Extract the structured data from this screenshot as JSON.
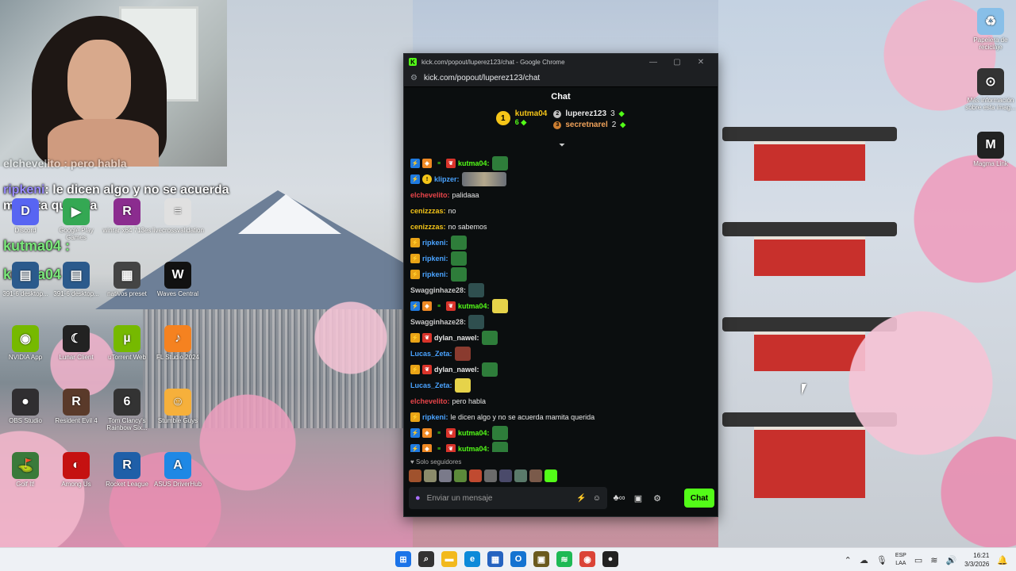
{
  "window": {
    "title": "kick.com/popout/luperez123/chat - Google Chrome",
    "url": "kick.com/popout/luperez123/chat",
    "controls": [
      "—",
      "▢",
      "✕"
    ]
  },
  "chat": {
    "header": "Chat",
    "leaderboard": {
      "first": {
        "rank": "1",
        "name": "kutma04",
        "count": "6"
      },
      "second": {
        "name": "luperez123",
        "count": "3"
      },
      "third": {
        "name": "secretnarel",
        "count": "2"
      }
    },
    "messages": [
      {
        "user": "kutma04",
        "color": "#53fc18",
        "text": "",
        "badges": [
          "blue",
          "orange",
          "green",
          "red"
        ],
        "emote": "green"
      },
      {
        "user": "klipzer",
        "color": "#4aa3ff",
        "text": "",
        "badges": [
          "blue",
          "yellow"
        ],
        "emote": "wide"
      },
      {
        "user": "elchevelito",
        "color": "#e8454a",
        "text": "palidaaa",
        "badges": []
      },
      {
        "user": "cenizzzas",
        "color": "#f5c518",
        "text": "no",
        "badges": []
      },
      {
        "user": "cenizzzas",
        "color": "#f5c518",
        "text": "no sabemos",
        "badges": []
      },
      {
        "user": "ripkeni",
        "color": "#4aa3ff",
        "text": "",
        "badges": [
          "gold"
        ],
        "emote": "green"
      },
      {
        "user": "ripkeni",
        "color": "#4aa3ff",
        "text": "",
        "badges": [
          "gold"
        ],
        "emote": "green"
      },
      {
        "user": "ripkeni",
        "color": "#4aa3ff",
        "text": "",
        "badges": [
          "gold"
        ],
        "emote": "green"
      },
      {
        "user": "Swagginhaze28",
        "color": "#c9c9c9",
        "text": "",
        "badges": [],
        "emote": "gray"
      },
      {
        "user": "kutma04",
        "color": "#53fc18",
        "text": "",
        "badges": [
          "blue",
          "orange",
          "green",
          "red"
        ],
        "emote": "yellow"
      },
      {
        "user": "Swagginhaze28",
        "color": "#c9c9c9",
        "text": "",
        "badges": [],
        "emote": "gray"
      },
      {
        "user": "dylan_nawel",
        "color": "#e8e8e8",
        "text": "",
        "badges": [
          "gold",
          "red"
        ],
        "emote": "green"
      },
      {
        "user": "Lucas_Zeta",
        "color": "#4aa3ff",
        "text": "",
        "badges": [],
        "emote": "red"
      },
      {
        "user": "dylan_nawel",
        "color": "#e8e8e8",
        "text": "",
        "badges": [
          "gold",
          "red"
        ],
        "emote": "green"
      },
      {
        "user": "Lucas_Zeta",
        "color": "#4aa3ff",
        "text": "",
        "badges": [],
        "emote": "yellow"
      },
      {
        "user": "elchevelito",
        "color": "#e8454a",
        "text": "pero habla",
        "badges": []
      },
      {
        "user": "ripkeni",
        "color": "#4aa3ff",
        "text": "le dicen algo y no se acuerda mamita querida",
        "badges": [
          "gold"
        ]
      },
      {
        "user": "kutma04",
        "color": "#53fc18",
        "text": "",
        "badges": [
          "blue",
          "orange",
          "green",
          "red"
        ],
        "emote": "green"
      },
      {
        "user": "kutma04",
        "color": "#53fc18",
        "text": "",
        "badges": [
          "blue",
          "orange",
          "green",
          "red"
        ],
        "emote": "green"
      }
    ],
    "followers_only": "Solo seguidores",
    "input_placeholder": "Enviar un mensaje",
    "send_label": "Chat"
  },
  "overlay": {
    "line1": "elchevelito : pero habla",
    "line2_user": "ripkeni",
    "line2_text": ": le dicen algo y no se acuerda mamita querida",
    "line3": "kutma04 :",
    "line4": "kutma04 :"
  },
  "desktop_icons": [
    {
      "label": "Discord",
      "color": "#5865f2",
      "glyph": "D"
    },
    {
      "label": "Google Play Games",
      "color": "#34a853",
      "glyph": "▶"
    },
    {
      "label": "winrar x64 713es",
      "color": "#8b2c8f",
      "glyph": "R"
    },
    {
      "label": "livecrossvalidation",
      "color": "#e0e0e0",
      "glyph": "≡"
    },
    {
      "label": "391-6 desktop...",
      "color": "#2b5a8c",
      "glyph": "▤"
    },
    {
      "label": "391-6 desktop...",
      "color": "#2b5a8c",
      "glyph": "▤"
    },
    {
      "label": "nativos preset",
      "color": "#444",
      "glyph": "▦"
    },
    {
      "label": "Waves Central",
      "color": "#111",
      "glyph": "W"
    },
    {
      "label": "NVIDIA App",
      "color": "#76b900",
      "glyph": "◉"
    },
    {
      "label": "Lunar Client",
      "color": "#222",
      "glyph": "☾"
    },
    {
      "label": "uTorrent Web",
      "color": "#76b900",
      "glyph": "µ"
    },
    {
      "label": "FL Studio 2024",
      "color": "#f58220",
      "glyph": "♪"
    },
    {
      "label": "OBS Studio",
      "color": "#302e31",
      "glyph": "●"
    },
    {
      "label": "Resident Evil 4",
      "color": "#5a3a2a",
      "glyph": "R"
    },
    {
      "label": "Tom Clancy's Rainbow Six...",
      "color": "#333",
      "glyph": "6"
    },
    {
      "label": "Stumble Guys",
      "color": "#f6b03b",
      "glyph": "☺"
    },
    {
      "label": "Golf It!",
      "color": "#3a7a3a",
      "glyph": "⛳"
    },
    {
      "label": "Among Us",
      "color": "#c51111",
      "glyph": "◐"
    },
    {
      "label": "Rocket League",
      "color": "#1f5fa8",
      "glyph": "R"
    },
    {
      "label": "ASUS DriverHub",
      "color": "#1e88e5",
      "glyph": "A"
    }
  ],
  "right_icons": [
    {
      "label": "Papelera de reciclaje",
      "color": "#88bfe8",
      "glyph": "♻"
    },
    {
      "label": "Más información sobre esta imag...",
      "color": "#333",
      "glyph": "⊙"
    },
    {
      "label": "Magma Link",
      "color": "#222",
      "glyph": "M"
    }
  ],
  "taskbar": {
    "apps": [
      {
        "name": "start-icon",
        "color": "#1a73e8",
        "glyph": "⊞"
      },
      {
        "name": "search-icon",
        "color": "#333",
        "glyph": "⌕"
      },
      {
        "name": "file-explorer-icon",
        "color": "#f2b91d",
        "glyph": "▬"
      },
      {
        "name": "edge-icon",
        "color": "#0c8ad9",
        "glyph": "e"
      },
      {
        "name": "calculator-icon",
        "color": "#2563c0",
        "glyph": "▦"
      },
      {
        "name": "outlook-icon",
        "color": "#1473d1",
        "glyph": "O"
      },
      {
        "name": "app-icon",
        "color": "#6b5a1e",
        "glyph": "▣"
      },
      {
        "name": "spotify-icon",
        "color": "#1db954",
        "glyph": "≋"
      },
      {
        "name": "chrome-icon",
        "color": "#db4437",
        "glyph": "◉"
      },
      {
        "name": "obs-icon",
        "color": "#222",
        "glyph": "●"
      }
    ],
    "lang_top": "ESP",
    "lang_bottom": "LAA",
    "time": "16:21",
    "date": "3/3/2026"
  }
}
